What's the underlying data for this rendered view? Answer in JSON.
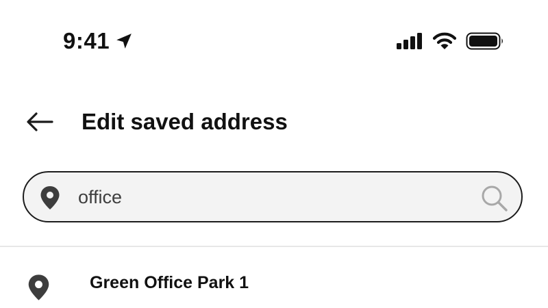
{
  "status_bar": {
    "time": "9:41",
    "icons": [
      "location-arrow-icon",
      "cellular-signal-icon",
      "wifi-icon",
      "battery-icon"
    ]
  },
  "header": {
    "back_icon": "arrow-left-icon",
    "title": "Edit saved address"
  },
  "search": {
    "leading_icon": "map-pin-icon",
    "value": "office",
    "trailing_icon": "search-icon"
  },
  "results": [
    {
      "icon": "map-pin-icon",
      "title": "Green Office Park 1"
    }
  ],
  "colors": {
    "text": "#111111",
    "search_bg": "#f3f3f3",
    "search_border": "#1b1b1b",
    "pin_fill": "#3d3d3d",
    "muted_icon": "#a8a8a8",
    "divider": "#e7e7e7"
  }
}
